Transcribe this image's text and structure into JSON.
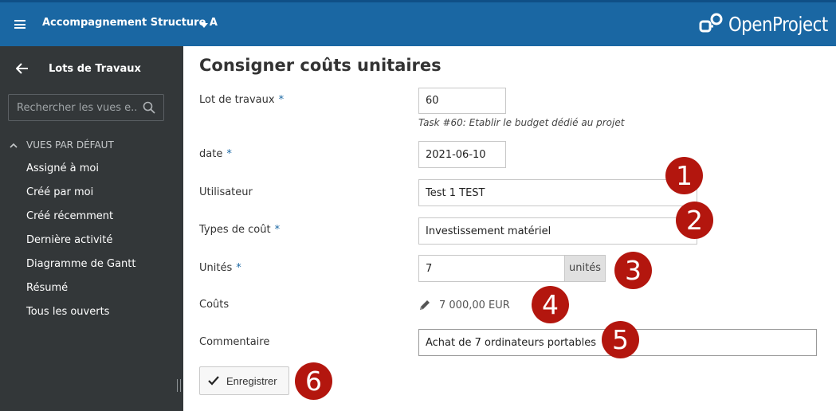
{
  "header": {
    "project_name": "Accompagnement Structure A",
    "logo_text": "OpenProject",
    "colors": {
      "header_bg": "#1a67a3",
      "sidebar_bg": "#333739",
      "badge": "#b3160e"
    }
  },
  "sidebar": {
    "title": "Lots de Travaux",
    "search_placeholder": "Rechercher les vues e...",
    "section_title": "VUES PAR DÉFAUT",
    "items": [
      {
        "label": "Assigné à moi"
      },
      {
        "label": "Créé par moi"
      },
      {
        "label": "Créé récemment"
      },
      {
        "label": "Dernière activité"
      },
      {
        "label": "Diagramme de Gantt"
      },
      {
        "label": "Résumé"
      },
      {
        "label": "Tous les ouverts"
      }
    ]
  },
  "form": {
    "title": "Consigner coûts unitaires",
    "work_package": {
      "label": "Lot de travaux",
      "required": "*",
      "value": "60",
      "hint": "Task #60: Etablir le budget dédié au projet"
    },
    "date": {
      "label": "date",
      "required": "*",
      "value": "2021-06-10"
    },
    "user": {
      "label": "Utilisateur",
      "value": "Test 1 TEST"
    },
    "cost_type": {
      "label": "Types de coût",
      "required": "*",
      "value": "Investissement matériel"
    },
    "units": {
      "label": "Unités",
      "required": "*",
      "value": "7",
      "unit_label": "unités"
    },
    "costs": {
      "label": "Coûts",
      "value": "7 000,00 EUR"
    },
    "comment": {
      "label": "Commentaire",
      "value": "Achat de 7 ordinateurs portables"
    },
    "save_label": "Enregistrer"
  },
  "annotations": [
    "1",
    "2",
    "3",
    "4",
    "5",
    "6"
  ]
}
